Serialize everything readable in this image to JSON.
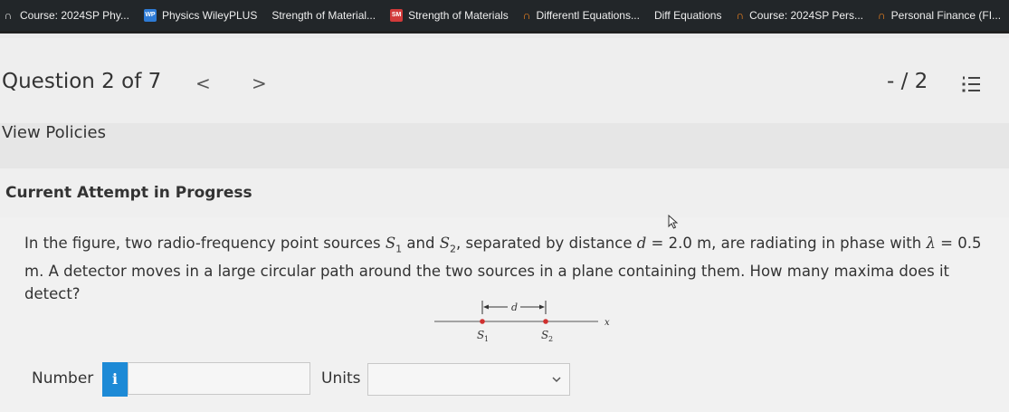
{
  "bookmarks": [
    {
      "icon": "course-icon",
      "glyph": "∩",
      "label": "Course: 2024SP Phy..."
    },
    {
      "icon": "wp-icon",
      "glyph": "WP",
      "label": "Physics WileyPLUS"
    },
    {
      "icon": "none",
      "glyph": "",
      "label": "Strength of Material..."
    },
    {
      "icon": "book-icon",
      "glyph": "SM",
      "label": "Strength of Materials"
    },
    {
      "icon": "course-icon",
      "glyph": "∩",
      "label": "Differentl Equations..."
    },
    {
      "icon": "none",
      "glyph": "",
      "label": "Diff Equations"
    },
    {
      "icon": "course-icon",
      "glyph": "∩",
      "label": "Course: 2024SP Pers..."
    },
    {
      "icon": "course-icon",
      "glyph": "∩",
      "label": "Personal Finance (FI..."
    }
  ],
  "header": {
    "title": "Question 2 of 7",
    "prev": "<",
    "next": ">",
    "score": "- / 2"
  },
  "policies": {
    "label": "View Policies"
  },
  "attempt": {
    "label": "Current Attempt in Progress"
  },
  "question": {
    "part1": "In the figure, two radio-frequency point sources ",
    "s": "S",
    "sub1": "1",
    "and": " and ",
    "sub2": "2",
    "part2": ", separated by distance ",
    "d": "d",
    "eq1": " = 2.0 m, are radiating in phase with ",
    "lambda": "λ",
    "eq2": " = 0.5 m. A detector moves in a large circular path around the two sources in a plane containing them. How many maxima does it detect?"
  },
  "figure": {
    "d_label": "d",
    "x_label": "x",
    "s1_label": "S",
    "s1_sub": "1",
    "s2_label": "S",
    "s2_sub": "2",
    "dot_color": "#d0302f"
  },
  "answer": {
    "number_label": "Number",
    "info": "i",
    "number_value": "",
    "units_label": "Units",
    "units_value": ""
  },
  "colors": {
    "accent": "#1d8ad6",
    "topbar": "#222629"
  }
}
